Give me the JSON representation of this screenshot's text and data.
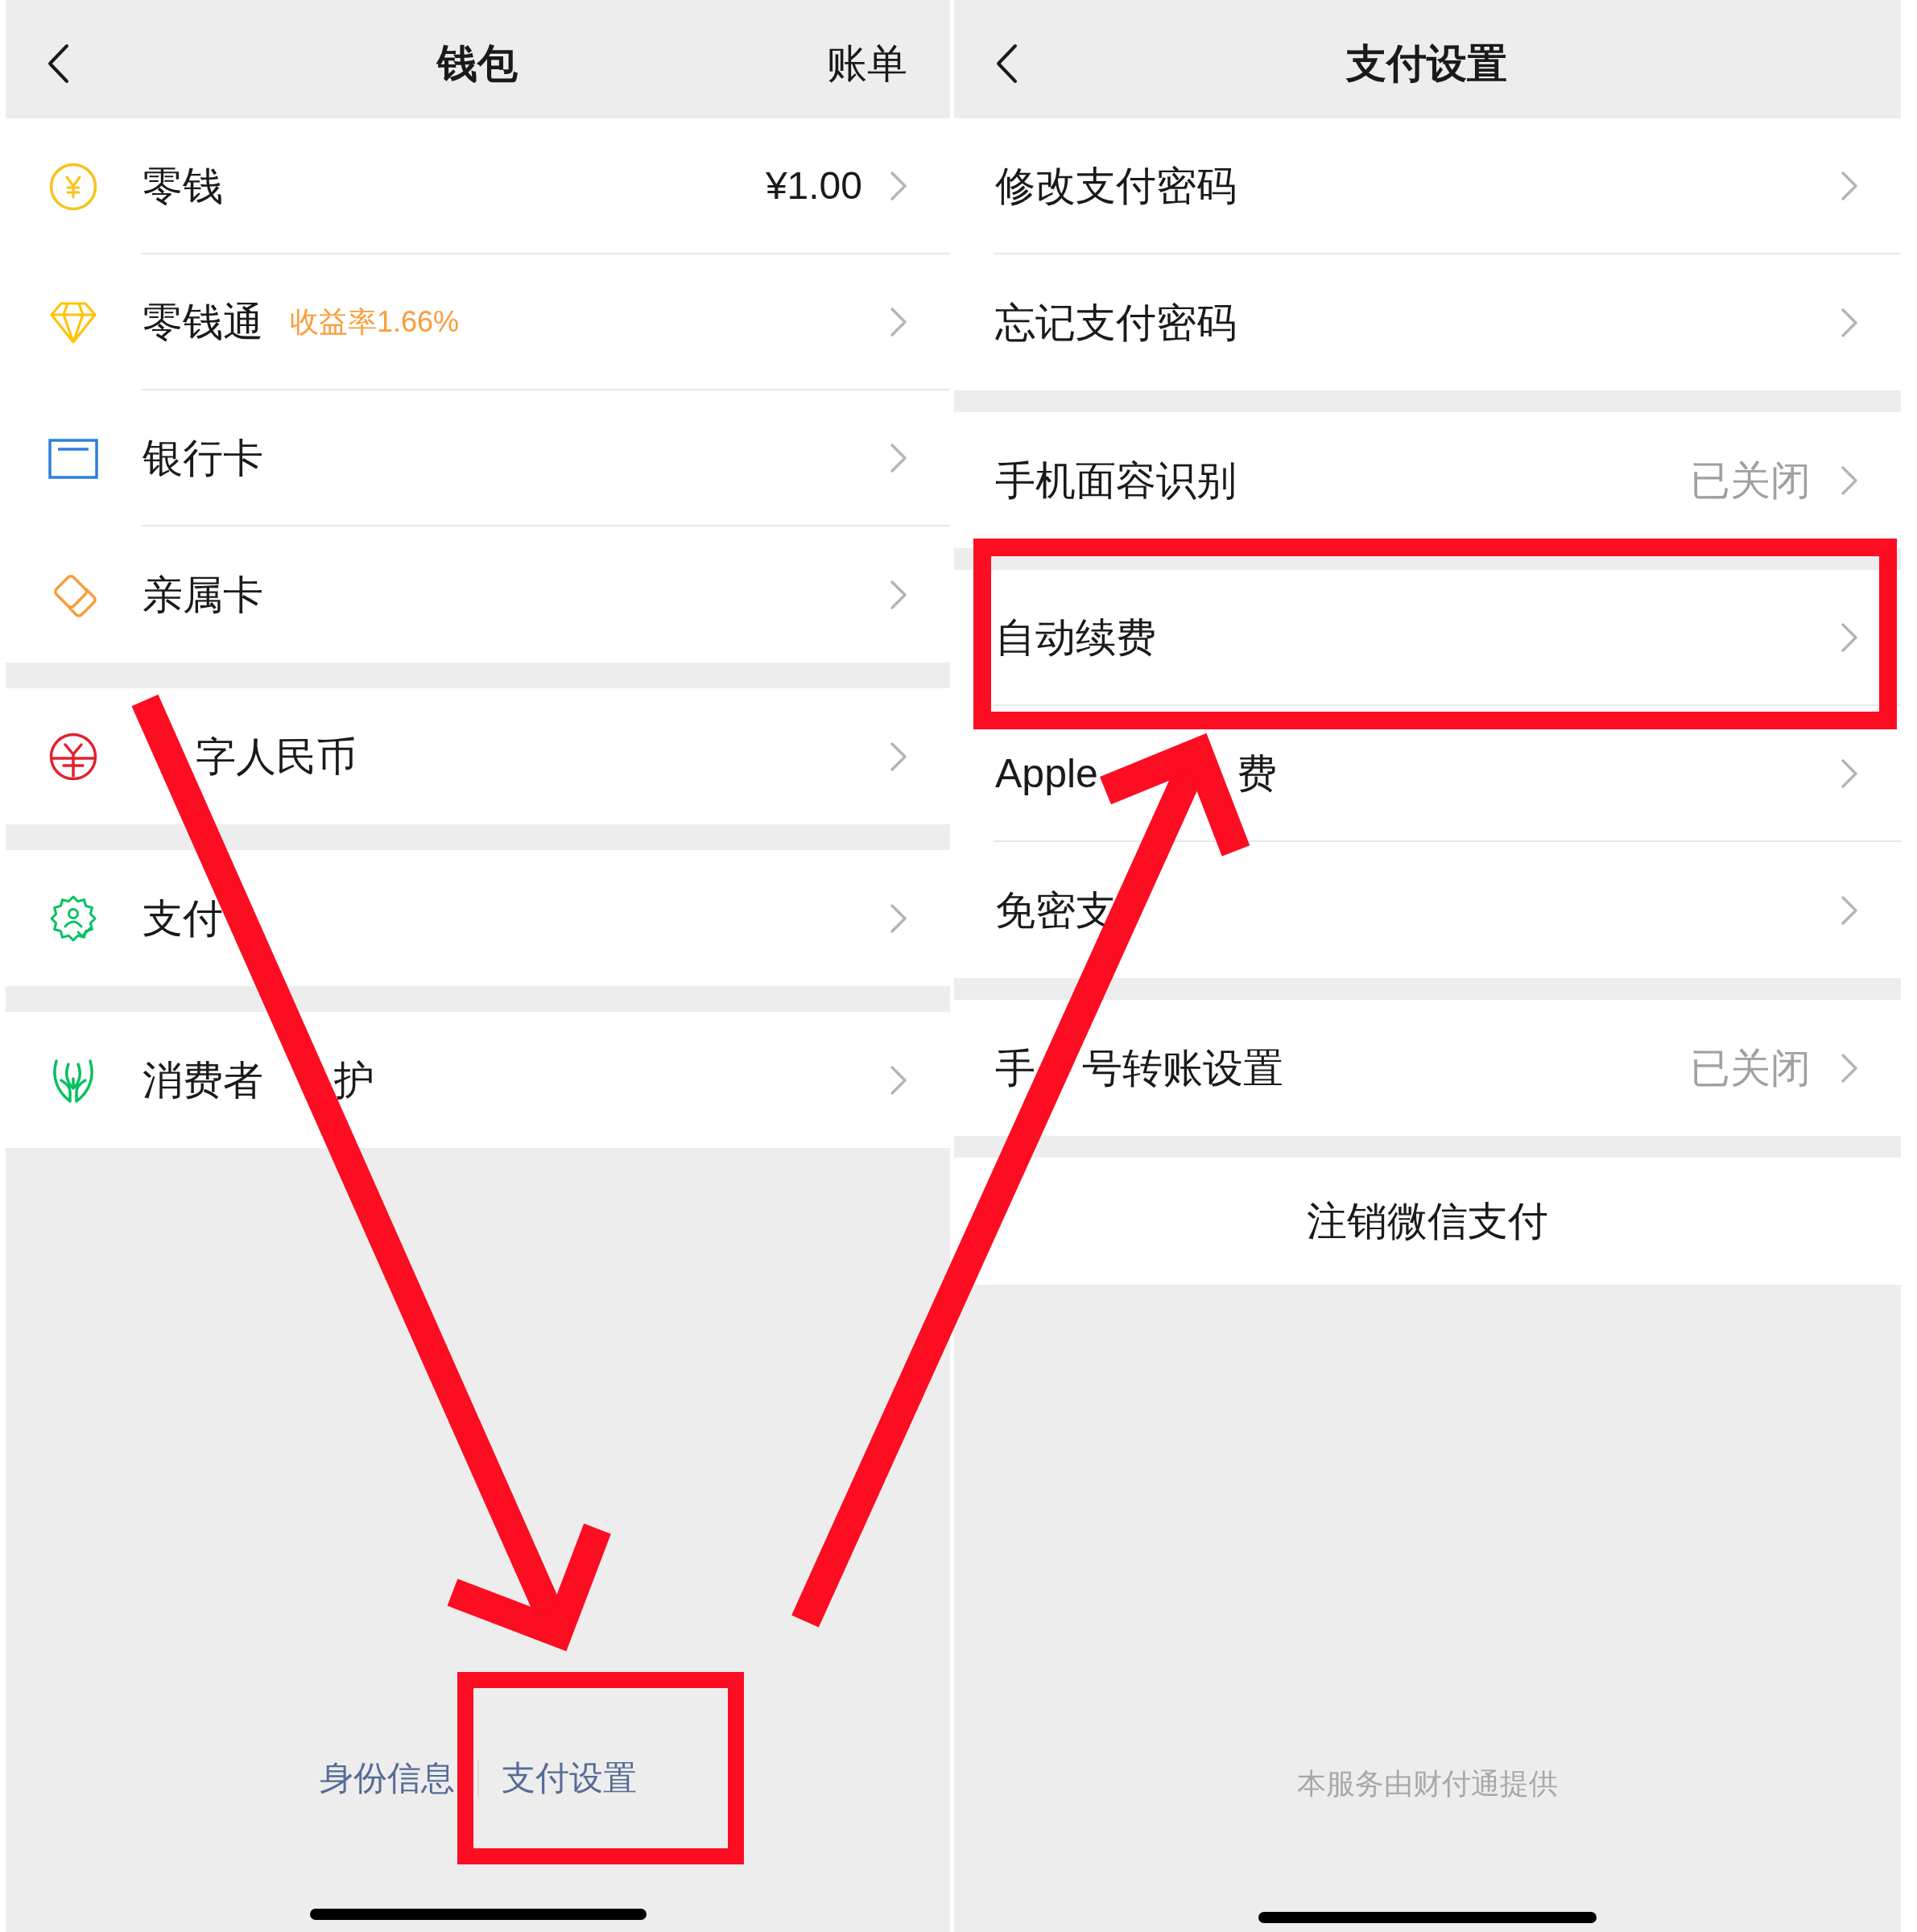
{
  "wallet": {
    "title": "钱包",
    "header_action": "账单",
    "sections": [
      {
        "rows": [
          {
            "label": [
              "零钱"
            ],
            "value": "¥1.00"
          },
          {
            "label": [
              "零钱通"
            ],
            "badge": "收益率1.66%"
          },
          {
            "label": [
              "银行卡"
            ]
          },
          {
            "label": [
              "亲属卡"
            ]
          }
        ]
      },
      {
        "rows": [
          {
            "label": [
              "字人民币"
            ]
          }
        ]
      },
      {
        "rows": [
          {
            "label": [
              "支付"
            ]
          }
        ]
      },
      {
        "rows": [
          {
            "label": [
              "消费者",
              "护"
            ]
          }
        ]
      }
    ],
    "footer_links": [
      {
        "label": "身份信息",
        "highlighted": false
      },
      {
        "label": "支付设置",
        "highlighted": true
      }
    ]
  },
  "pay_settings": {
    "title": "支付设置",
    "sections": [
      {
        "rows": [
          {
            "label": [
              "修改支付密码"
            ],
            "highlighted": false
          },
          {
            "label": [
              "忘记支付密码"
            ],
            "highlighted": false
          }
        ]
      },
      {
        "rows": [
          {
            "label": [
              "手机面容识别"
            ],
            "status": "已关闭",
            "highlighted": false
          }
        ]
      },
      {
        "rows": [
          {
            "label": [
              "自动续费"
            ],
            "highlighted": true
          },
          {
            "label": [
              "Apple",
              "费"
            ],
            "highlighted": false
          },
          {
            "label": [
              "免密支"
            ],
            "highlighted": false
          }
        ]
      },
      {
        "rows": [
          {
            "label": [
              "手",
              "号转账设置"
            ],
            "status": "已关闭",
            "highlighted": false
          }
        ]
      }
    ],
    "deregister_button": "注销微信支付",
    "footer_note": "本服务由财付通提供"
  }
}
